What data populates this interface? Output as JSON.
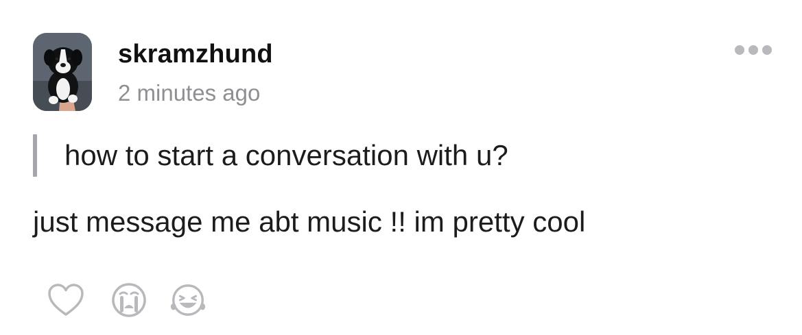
{
  "post": {
    "author": {
      "username": "skramzhund",
      "avatar_icon": "puppy-photo-avatar"
    },
    "timestamp": "2 minutes ago",
    "more_icon": "more-horizontal-icon",
    "question": "how to start a conversation with u?",
    "answer": "just message me abt music !! im pretty cool",
    "reactions": [
      {
        "icon": "heart-icon"
      },
      {
        "icon": "crying-face-icon"
      },
      {
        "icon": "laughing-face-icon"
      }
    ]
  },
  "colors": {
    "text": "#1c1c1e",
    "muted": "#8e8e93",
    "icon": "#b8b8bd",
    "quote_bar": "#a6a6ab"
  }
}
